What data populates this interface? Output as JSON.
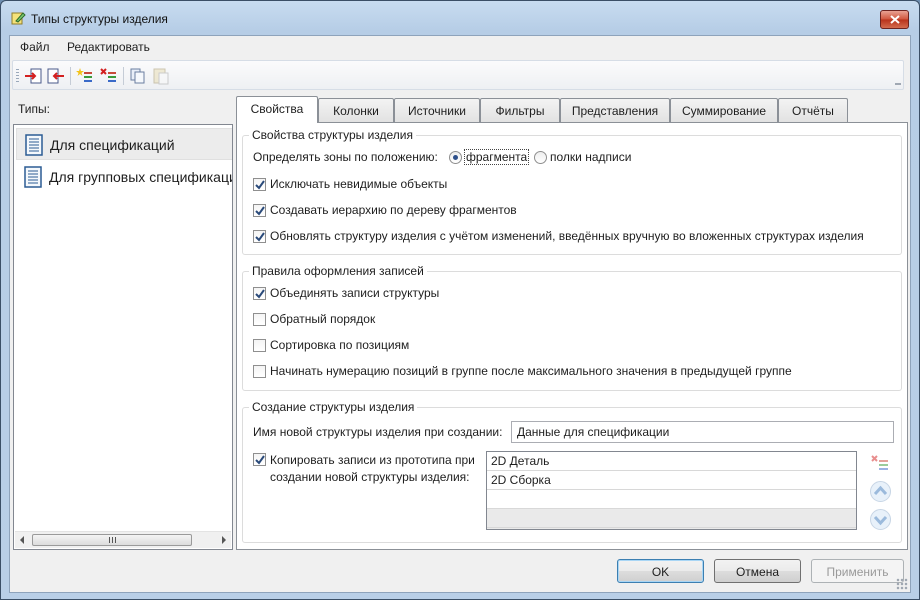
{
  "window": {
    "title": "Типы структуры изделия"
  },
  "menu": [
    {
      "label": "Файл"
    },
    {
      "label": "Редактировать"
    }
  ],
  "toolbar": {
    "icons": [
      "move-in-icon",
      "move-out-icon",
      "add-item-icon",
      "delete-item-icon",
      "copy-icon",
      "paste-icon"
    ]
  },
  "types_panel": {
    "label": "Типы:",
    "items": [
      {
        "label": "Для спецификаций",
        "selected": true
      },
      {
        "label": "Для групповых спецификаций",
        "selected": false
      }
    ]
  },
  "tabs": [
    {
      "label": "Свойства",
      "active": true
    },
    {
      "label": "Колонки"
    },
    {
      "label": "Источники"
    },
    {
      "label": "Фильтры"
    },
    {
      "label": "Представления"
    },
    {
      "label": "Суммирование"
    },
    {
      "label": "Отчёты"
    }
  ],
  "properties": {
    "group_structure": {
      "title": "Свойства структуры изделия",
      "zones_label": "Определять зоны по положению:",
      "radio_fragment": "фрагмента",
      "radio_stamp": "полки надписи",
      "selected_zone": "фрагмента",
      "cb_invisible": {
        "label": "Исключать невидимые объекты",
        "checked": true
      },
      "cb_hierarchy": {
        "label": "Создавать иерархию по дереву фрагментов",
        "checked": true
      },
      "cb_update": {
        "label": "Обновлять структуру изделия с учётом изменений, введённых вручную во вложенных структурах изделия",
        "checked": true
      }
    },
    "group_records": {
      "title": "Правила оформления записей",
      "cb_merge": {
        "label": "Объединять записи структуры",
        "checked": true
      },
      "cb_reverse": {
        "label": "Обратный порядок",
        "checked": false
      },
      "cb_sort": {
        "label": "Сортировка по позициям",
        "checked": false
      },
      "cb_numbering": {
        "label": "Начинать нумерацию позиций в группе после максимального значения в предыдущей группе",
        "checked": false
      }
    },
    "group_creation": {
      "title": "Создание структуры изделия",
      "name_label": "Имя новой структуры изделия при создании:",
      "name_value": "Данные для спецификации",
      "cb_copy": {
        "label": "Копировать записи из прототипа при создании новой структуры изделия:",
        "checked": true
      },
      "prototype_rows": [
        "2D Деталь",
        "2D Сборка",
        "",
        ""
      ]
    }
  },
  "buttons": {
    "ok": "OK",
    "cancel": "Отмена",
    "apply": "Применить"
  }
}
